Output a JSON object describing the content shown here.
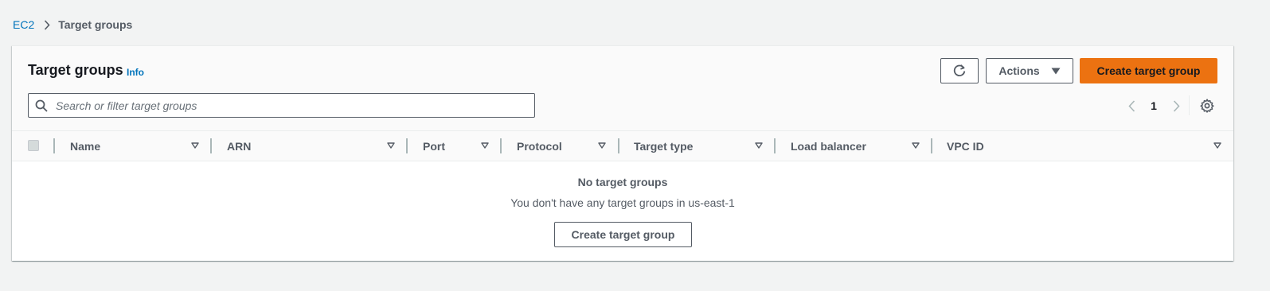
{
  "breadcrumb": {
    "root": "EC2",
    "current": "Target groups"
  },
  "panel": {
    "title": "Target groups",
    "info_link": "Info",
    "actions_label": "Actions",
    "create_label": "Create target group",
    "search_placeholder": "Search or filter target groups",
    "page_number": "1"
  },
  "table": {
    "columns": [
      "Name",
      "ARN",
      "Port",
      "Protocol",
      "Target type",
      "Load balancer",
      "VPC ID"
    ]
  },
  "empty_state": {
    "title": "No target groups",
    "description": "You don't have any target groups in us-east-1",
    "button_label": "Create target group"
  },
  "colors": {
    "link": "#0073bb",
    "primary_button": "#ec7211",
    "background": "#f2f3f3"
  },
  "icons": {
    "breadcrumb_separator": "chevron-right-icon",
    "refresh": "refresh-icon",
    "actions_caret": "caret-down-icon",
    "search": "search-icon",
    "pager_prev": "chevron-left-icon",
    "pager_next": "chevron-right-icon",
    "settings": "gear-icon",
    "sort": "sort-caret-icon"
  }
}
